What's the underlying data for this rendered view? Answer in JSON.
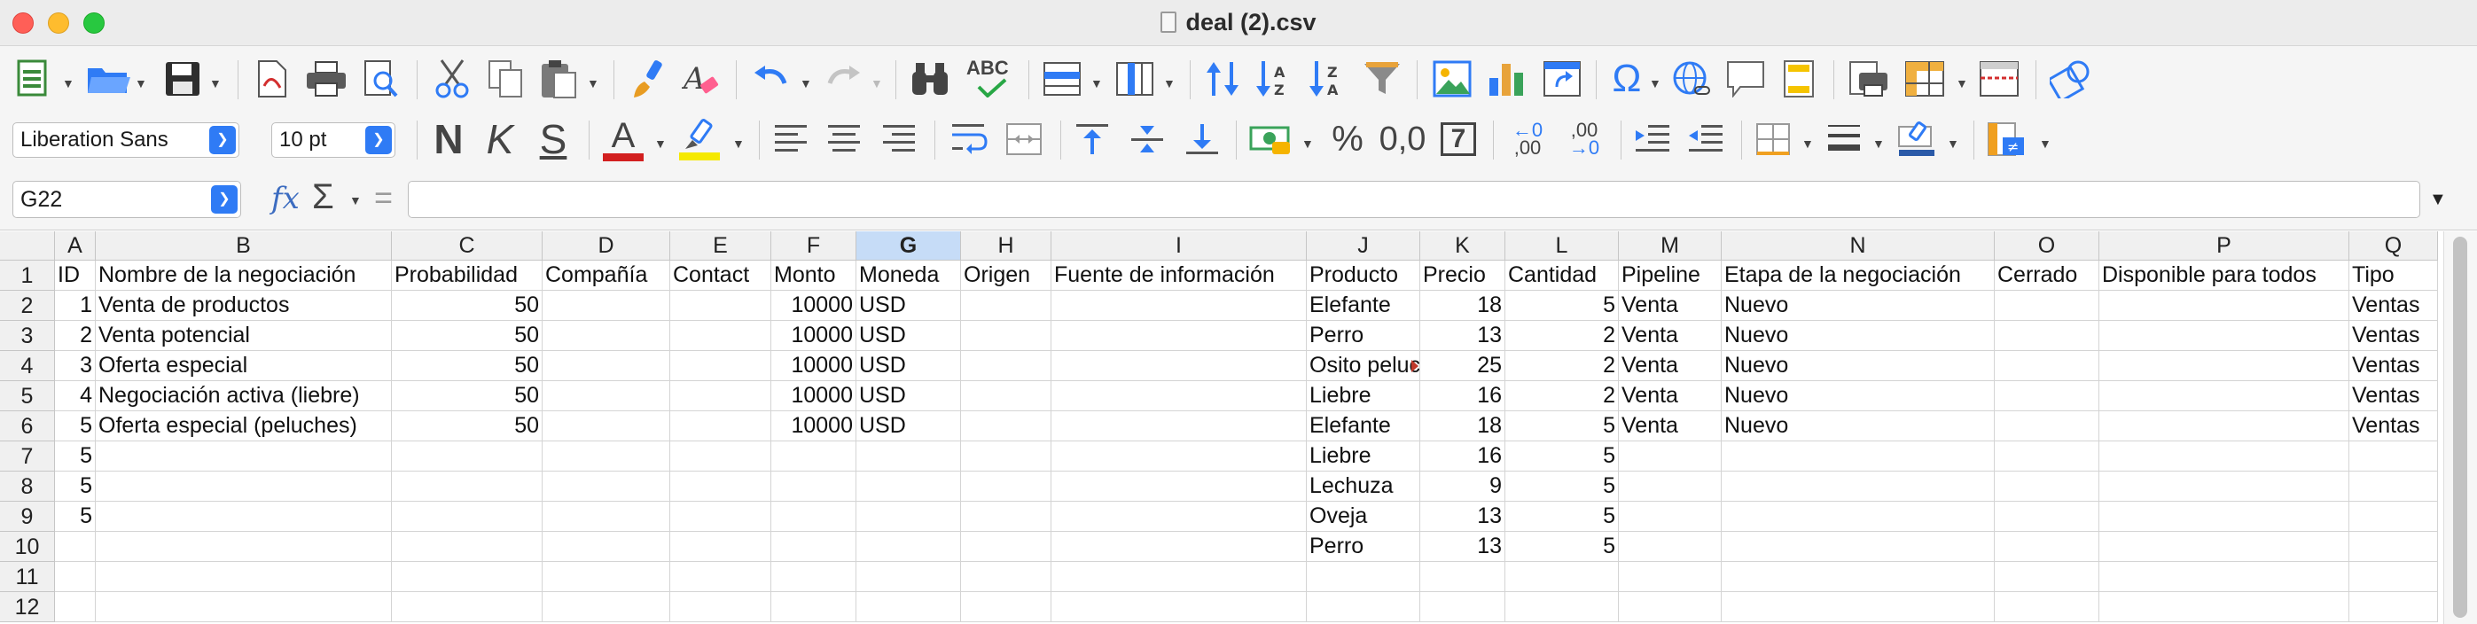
{
  "window": {
    "title": "deal (2).csv",
    "close_glyph": "×",
    "minimize_glyph": "−",
    "zoom_glyph": "+"
  },
  "toolbar": {
    "font_name": "Liberation Sans",
    "font_size": "10 pt",
    "bold_label": "N",
    "italic_label": "K",
    "strike_label": "S",
    "font_color_label": "A",
    "spell_label": "ABC",
    "percent_label": "%",
    "decimal_format_label": "0,0",
    "number_format_label": "7",
    "add_decimal_top": "←0",
    "add_decimal_bottom": ",00",
    "del_decimal_top": ",00",
    "del_decimal_bottom": "→0",
    "special_char_label": "Ω",
    "accent_color": "#2f7bf5",
    "font_color_bar": "#d21f1f",
    "highlight_color_bar": "#f5e900"
  },
  "formula_bar": {
    "name_box": "G22",
    "fx_label": "fx",
    "sigma_label": "Σ",
    "equals_label": "=",
    "content": ""
  },
  "sheet": {
    "columns": [
      "A",
      "B",
      "C",
      "D",
      "E",
      "F",
      "G",
      "H",
      "I",
      "J",
      "K",
      "L",
      "M",
      "N",
      "O",
      "P",
      "Q"
    ],
    "selected_column": "G",
    "rows": [
      "1",
      "2",
      "3",
      "4",
      "5",
      "6",
      "7",
      "8",
      "9",
      "10",
      "11",
      "12"
    ],
    "cells": {
      "r1": [
        "ID",
        "Nombre de la negociación",
        "Probabilidad",
        "Compañía",
        "Contact",
        "Monto",
        "Moneda",
        "Origen",
        "Fuente de información",
        "Producto",
        "Precio",
        "Cantidad",
        "Pipeline",
        "Etapa de la negociación",
        "Cerrado",
        "Disponible para todos",
        "Tipo"
      ],
      "r2": [
        "1",
        "Venta de productos",
        "50",
        "",
        "",
        "10000",
        "USD",
        "",
        "",
        "Elefante",
        "18",
        "5",
        "Venta",
        "Nuevo",
        "",
        "",
        "Ventas"
      ],
      "r3": [
        "2",
        "Venta potencial",
        "50",
        "",
        "",
        "10000",
        "USD",
        "",
        "",
        "Perro",
        "13",
        "2",
        "Venta",
        "Nuevo",
        "",
        "",
        "Ventas"
      ],
      "r4": [
        "3",
        "Oferta especial",
        "50",
        "",
        "",
        "10000",
        "USD",
        "",
        "",
        "Osito peluche",
        "25",
        "2",
        "Venta",
        "Nuevo",
        "",
        "",
        "Ventas"
      ],
      "r5": [
        "4",
        "Negociación activa (liebre)",
        "50",
        "",
        "",
        "10000",
        "USD",
        "",
        "",
        "Liebre",
        "16",
        "2",
        "Venta",
        "Nuevo",
        "",
        "",
        "Ventas"
      ],
      "r6": [
        "5",
        "Oferta especial (peluches)",
        "50",
        "",
        "",
        "10000",
        "USD",
        "",
        "",
        "Elefante",
        "18",
        "5",
        "Venta",
        "Nuevo",
        "",
        "",
        "Ventas"
      ],
      "r7": [
        "5",
        "",
        "",
        "",
        "",
        "",
        "",
        "",
        "",
        "Liebre",
        "16",
        "5",
        "",
        "",
        "",
        "",
        ""
      ],
      "r8": [
        "5",
        "",
        "",
        "",
        "",
        "",
        "",
        "",
        "",
        "Lechuza",
        "9",
        "5",
        "",
        "",
        "",
        "",
        ""
      ],
      "r9": [
        "5",
        "",
        "",
        "",
        "",
        "",
        "",
        "",
        "",
        "Oveja",
        "13",
        "5",
        "",
        "",
        "",
        "",
        ""
      ],
      "r10": [
        "",
        "",
        "",
        "",
        "",
        "",
        "",
        "",
        "",
        "Perro",
        "13",
        "5",
        "",
        "",
        "",
        "",
        ""
      ],
      "r11": [
        "",
        "",
        "",
        "",
        "",
        "",
        "",
        "",
        "",
        "",
        "",
        "",
        "",
        "",
        "",
        "",
        ""
      ],
      "r12": [
        "",
        "",
        "",
        "",
        "",
        "",
        "",
        "",
        "",
        "",
        "",
        "",
        "",
        "",
        "",
        "",
        ""
      ]
    },
    "numeric_columns": [
      "A",
      "C",
      "F",
      "K",
      "L"
    ]
  }
}
